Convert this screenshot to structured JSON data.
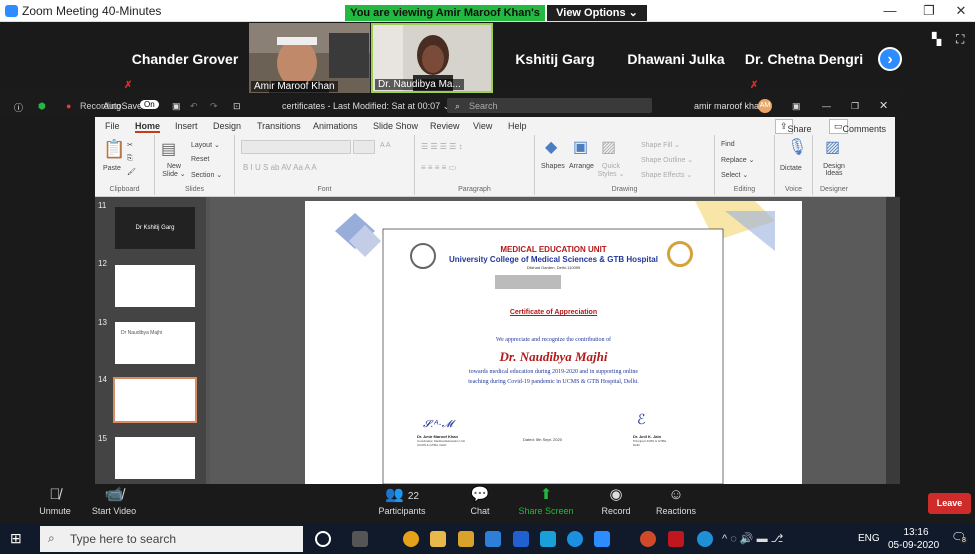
{
  "zoom": {
    "window_title": "Zoom Meeting 40-Minutes",
    "viewing_banner": "You are viewing Amir Maroof Khan's screen",
    "view_options": "View Options ⌄",
    "participants_strip": [
      {
        "name": "Chander Grover"
      },
      {
        "name": "Amir Maroof Khan",
        "video": true
      },
      {
        "name": "Dr. Naudibya Ma...",
        "video": true
      },
      {
        "name": "Kshitij Garg"
      },
      {
        "name": "Dhawani Julka"
      },
      {
        "name": "Dr. Chetna Dengri"
      }
    ],
    "controls": {
      "unmute": "Unmute",
      "start_video": "Start Video",
      "participants": "Participants",
      "participants_count": "22",
      "chat": "Chat",
      "share_screen": "Share Screen",
      "record": "Record",
      "reactions": "Reactions",
      "leave": "Leave"
    }
  },
  "ppt": {
    "recording": "Recording",
    "autosave": "AutoSave",
    "autosave_state": "On",
    "doc_title": "certificates - Last Modified: Sat at 00:07 ⌄",
    "search_placeholder": "Search",
    "user": "amir maroof khan",
    "user_initials": "AM",
    "tabs": [
      "File",
      "Home",
      "Insert",
      "Design",
      "Transitions",
      "Animations",
      "Slide Show",
      "Review",
      "View",
      "Help"
    ],
    "share": "Share",
    "comments": "Comments",
    "groups": {
      "clipboard": "Clipboard",
      "slides": "Slides",
      "font": "Font",
      "paragraph": "Paragraph",
      "drawing": "Drawing",
      "editing": "Editing",
      "voice": "Voice",
      "designer": "Designer"
    },
    "buttons": {
      "paste": "Paste",
      "new_slide": "New Slide ⌄",
      "layout": "Layout ⌄",
      "reset": "Reset",
      "section": "Section ⌄",
      "shapes": "Shapes",
      "arrange": "Arrange",
      "quick_styles": "Quick Styles ⌄",
      "shape_fill": "Shape Fill ⌄",
      "shape_outline": "Shape Outline ⌄",
      "shape_effects": "Shape Effects ⌄",
      "find": "Find",
      "replace": "Replace ⌄",
      "select": "Select ⌄",
      "dictate": "Dictate",
      "design_ideas": "Design Ideas"
    },
    "thumbnails": [
      {
        "num": "11",
        "text": "Dr Kshitij Garg"
      },
      {
        "num": "12",
        "text": ""
      },
      {
        "num": "13",
        "text": "Dr Naudibya Majhi"
      },
      {
        "num": "14",
        "text": ""
      },
      {
        "num": "15",
        "text": ""
      }
    ],
    "certificate": {
      "unit": "MEDICAL EDUCATION UNIT",
      "college": "University College of Medical Sciences & GTB Hospital",
      "address": "Dilshad Garden, Delhi-110095",
      "heading": "Certificate of Appreciation",
      "line1": "We appreciate and recognize the contribution of",
      "recipient": "Dr. Naudibya Majhi",
      "line2": "towards medical education during 2019-2020 and in supporting online",
      "line3": "teaching during Covid-19 pandemic in UCMS & GTB Hospital, Delhi.",
      "sig1_name": "Dr. Amir Maroof Khan",
      "sig1_title": "Coordinator, Medical Education Unit UCMS & GTBH, Delhi",
      "date": "Dated: 5th Sept. 2020",
      "sig2_name": "Dr. Anil K. Jain",
      "sig2_title": "Principal UCMS & GTBH, Delhi"
    }
  },
  "taskbar": {
    "search_placeholder": "Type here to search",
    "lang": "ENG",
    "time": "13:16",
    "date": "05-09-2020",
    "notifications": "8"
  }
}
